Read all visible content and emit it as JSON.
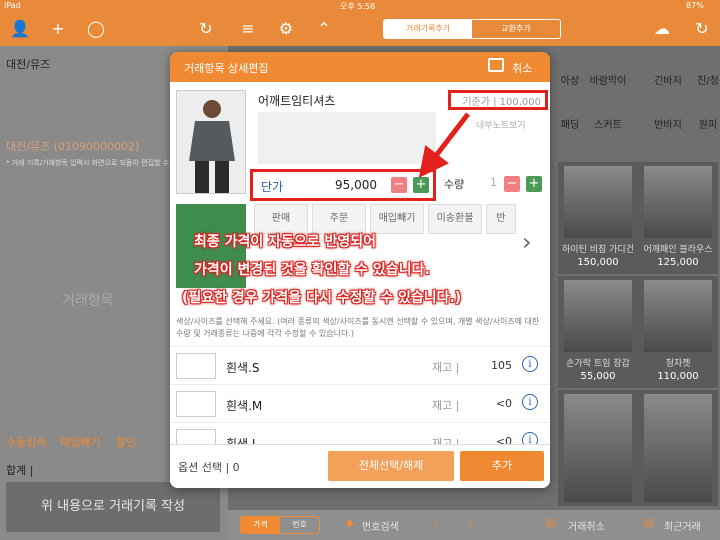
{
  "status": {
    "device": "iPad",
    "time": "오후 5:58",
    "battery": "87%"
  },
  "tabs": [
    {
      "label": "거래기록추가"
    },
    {
      "label": "교환추가"
    }
  ],
  "left": {
    "customer": "대전/뮤즈",
    "customer_detail": "대전/뮤즈 (01090000002)",
    "customer_note": "* 거래 기록/거래항목 입력시 화면으로 되돌아 편집할 수 있습니다.",
    "empty_label": "거래항목",
    "tabs": [
      "수동입력",
      "매입빼기",
      "할인"
    ],
    "total_label": "합계 |",
    "write_button": "위 내용으로 거래기록 작성"
  },
  "categories": [
    "아상",
    "바람막이",
    "긴바지",
    "진/청",
    "패딩",
    "스커트",
    "반바지",
    "원피"
  ],
  "products": [
    {
      "name": "하이틴 비침 가디건",
      "price": "150,000"
    },
    {
      "name": "어깨패인 블라우스",
      "price": "125,000"
    },
    {
      "name": "손가락 트임 장갑",
      "price": "55,000"
    },
    {
      "name": "청자켓",
      "price": "110,000"
    },
    {
      "name": "",
      "price": ""
    },
    {
      "name": "",
      "price": ""
    }
  ],
  "bottom": {
    "toggle": [
      "가격",
      "번호"
    ],
    "search": "번호검색",
    "cancel": "거래취소",
    "recent": "최근거래"
  },
  "modal": {
    "title": "거래항목 상세편집",
    "cancel": "취소",
    "product_name": "어깨트임티셔츠",
    "base_price": "기준가 | 100,000",
    "memo_link": "내부노트보기",
    "unit_price_label": "단가",
    "unit_price": "95,000",
    "qty_label": "수량",
    "qty": "1",
    "type_buttons": [
      "판매",
      "주문",
      "매입빼기",
      "미송환불",
      "반"
    ],
    "help": "색상/사이즈를 선택해 주세요. (여러 종류의 색상/사이즈를 동시엔 선택할 수 있으며, 개별 색상/사이즈에 대한 수량 및 거래종류는 나중에 각각 수정할 수 있습니다.)",
    "options": [
      {
        "name": "흰색.S",
        "stock_label": "재고 |",
        "stock": "105"
      },
      {
        "name": "흰색.M",
        "stock_label": "재고 |",
        "stock": "<0"
      },
      {
        "name": "흰색.L",
        "stock_label": "재고 |",
        "stock": "<0"
      }
    ],
    "option_select": "옵션 선택 | 0",
    "select_all": "전체선택/해제",
    "add": "추가"
  },
  "annotation": [
    "최종 가격이 자동으로 반영되어",
    "가격이 변경된 것을 확인할 수 있습니다.",
    "(필요한 경우 가격을 다시 수정할 수 있습니다.)"
  ],
  "colors": {
    "accent": "#f08a32",
    "highlight": "#e32019",
    "green": "#4c9a58"
  }
}
